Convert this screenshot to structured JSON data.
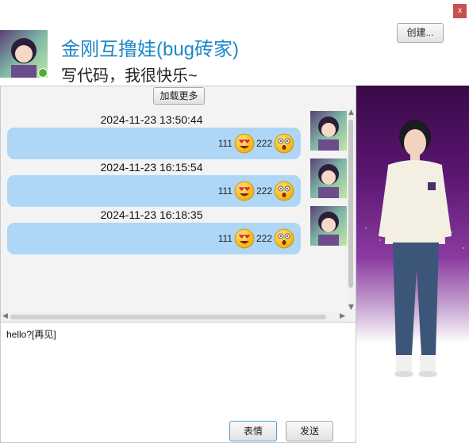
{
  "window": {
    "close_label": "x"
  },
  "profile": {
    "nickname": "金刚互撸娃(bug砖家)",
    "signature": "写代码，我很快乐~",
    "create_button_label": "创建..."
  },
  "chat": {
    "load_more_label": "加载更多",
    "messages": [
      {
        "time": "2024-11-23 13:50:44",
        "text_a": "111",
        "text_b": "222",
        "emojis": [
          "heart-eyes-emoji-icon",
          "surprised-emoji-icon"
        ]
      },
      {
        "time": "2024-11-23 16:15:54",
        "text_a": "111",
        "text_b": "222",
        "emojis": [
          "heart-eyes-emoji-icon",
          "surprised-emoji-icon"
        ]
      },
      {
        "time": "2024-11-23 16:18:35",
        "text_a": "111",
        "text_b": "222",
        "emojis": [
          "heart-eyes-emoji-icon",
          "surprised-emoji-icon"
        ]
      }
    ]
  },
  "input": {
    "value": "hello?[再见]",
    "emoji_button_label": "表情",
    "send_button_label": "发送"
  },
  "colors": {
    "nickname": "#1e88c8",
    "bubble": "#aed7f7",
    "close_button": "#c75050"
  }
}
